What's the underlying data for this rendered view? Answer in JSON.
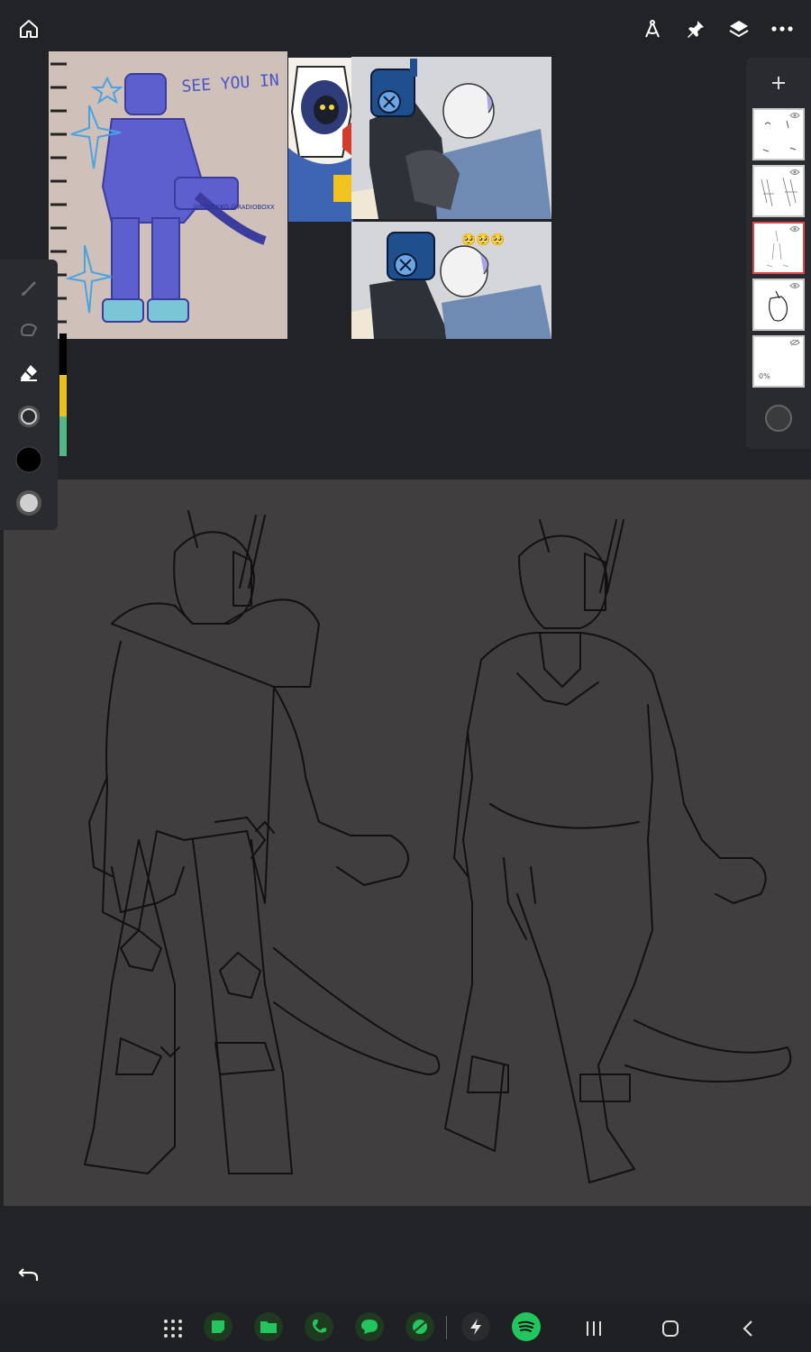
{
  "top_bar": {
    "home": "home-icon",
    "right_icons": [
      "compass-ruler-icon",
      "pin-icon",
      "layers-icon",
      "more-icon"
    ]
  },
  "reference_images": {
    "notebook_text": "SEE YOU IN HELL",
    "credit_text": "@RZJZIKKO @RADIOBOXX",
    "emoji_caption": "🥺🥺🥺"
  },
  "layers": [
    {
      "name": "layer-1",
      "visible": true
    },
    {
      "name": "layer-2",
      "visible": true
    },
    {
      "name": "layer-3",
      "visible": true,
      "active": true
    },
    {
      "name": "layer-4",
      "visible": true
    },
    {
      "name": "layer-5",
      "visible": false,
      "opacity_label": "0%"
    }
  ],
  "left_tools": [
    "brush-icon",
    "smudge-icon",
    "eraser-icon",
    "brush-size-icon",
    "color-swatch-icon",
    "opacity-icon"
  ],
  "colors": {
    "background": "#222327",
    "canvas": "#413e40",
    "active_layer": "#e0474b",
    "yellow_slider": "#e6c21f",
    "teal_slider": "#58b58a",
    "app_green": "#22c55e"
  },
  "bottom_apps": [
    "app-drawer-icon",
    "notes-icon",
    "files-icon",
    "phone-icon",
    "messages-icon",
    "browser-icon",
    "flash-icon",
    "spotify-icon"
  ],
  "system_nav": [
    "recents-icon",
    "home-nav-icon",
    "back-icon"
  ]
}
